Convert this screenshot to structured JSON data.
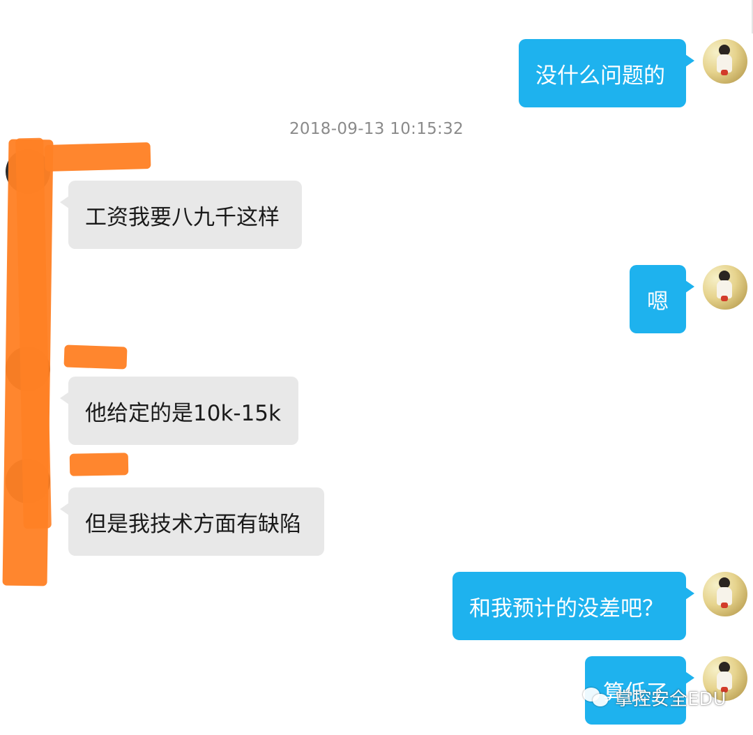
{
  "timestamp": "2018-09-13 10:15:32",
  "messages": [
    {
      "side": "out",
      "text": "没什么问题的"
    },
    {
      "side": "in",
      "text": "工资我要八九千这样"
    },
    {
      "side": "out",
      "text": "嗯"
    },
    {
      "side": "in",
      "text": "他给定的是10k-15k"
    },
    {
      "side": "in",
      "text": "但是我技术方面有缺陷"
    },
    {
      "side": "out",
      "text": "和我预计的没差吧？"
    },
    {
      "side": "out",
      "text": "算低了"
    }
  ],
  "watermark": {
    "text": "掌控安全EDU",
    "icon": "wechat-icon"
  },
  "colors": {
    "outgoing_bubble": "#1eb2ee",
    "incoming_bubble": "#e8e8e8",
    "redaction": "#ff8125"
  }
}
